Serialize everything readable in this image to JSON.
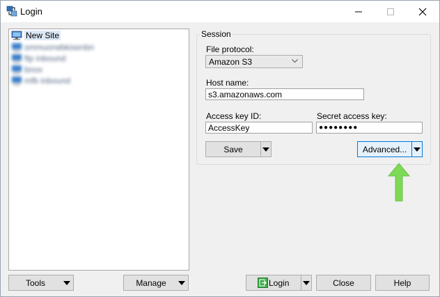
{
  "window": {
    "title": "Login"
  },
  "site_tree": {
    "items": [
      {
        "label": "New Site",
        "selected": true,
        "blurred": false
      },
      {
        "label": "smmuorwbkisenbn",
        "selected": false,
        "blurred": true
      },
      {
        "label": "ftp inbound",
        "selected": false,
        "blurred": true
      },
      {
        "label": "bnox",
        "selected": false,
        "blurred": true
      },
      {
        "label": "mfb inbound",
        "selected": false,
        "blurred": true
      }
    ]
  },
  "session": {
    "group_label": "Session",
    "file_protocol_label": "File protocol:",
    "file_protocol_value": "Amazon S3",
    "host_name_label": "Host name:",
    "host_name_value": "s3.amazonaws.com",
    "access_key_label": "Access key ID:",
    "access_key_value": "AccessKey",
    "secret_key_label": "Secret access key:",
    "secret_key_value": "●●●●●●●●",
    "save_label": "Save",
    "advanced_label": "Advanced..."
  },
  "footer": {
    "tools_label": "Tools",
    "manage_label": "Manage",
    "login_label": "Login",
    "close_label": "Close",
    "help_label": "Help"
  },
  "colors": {
    "accent": "#0078d7",
    "annotation_arrow": "#7ed957",
    "selection": "#dde8f6"
  }
}
